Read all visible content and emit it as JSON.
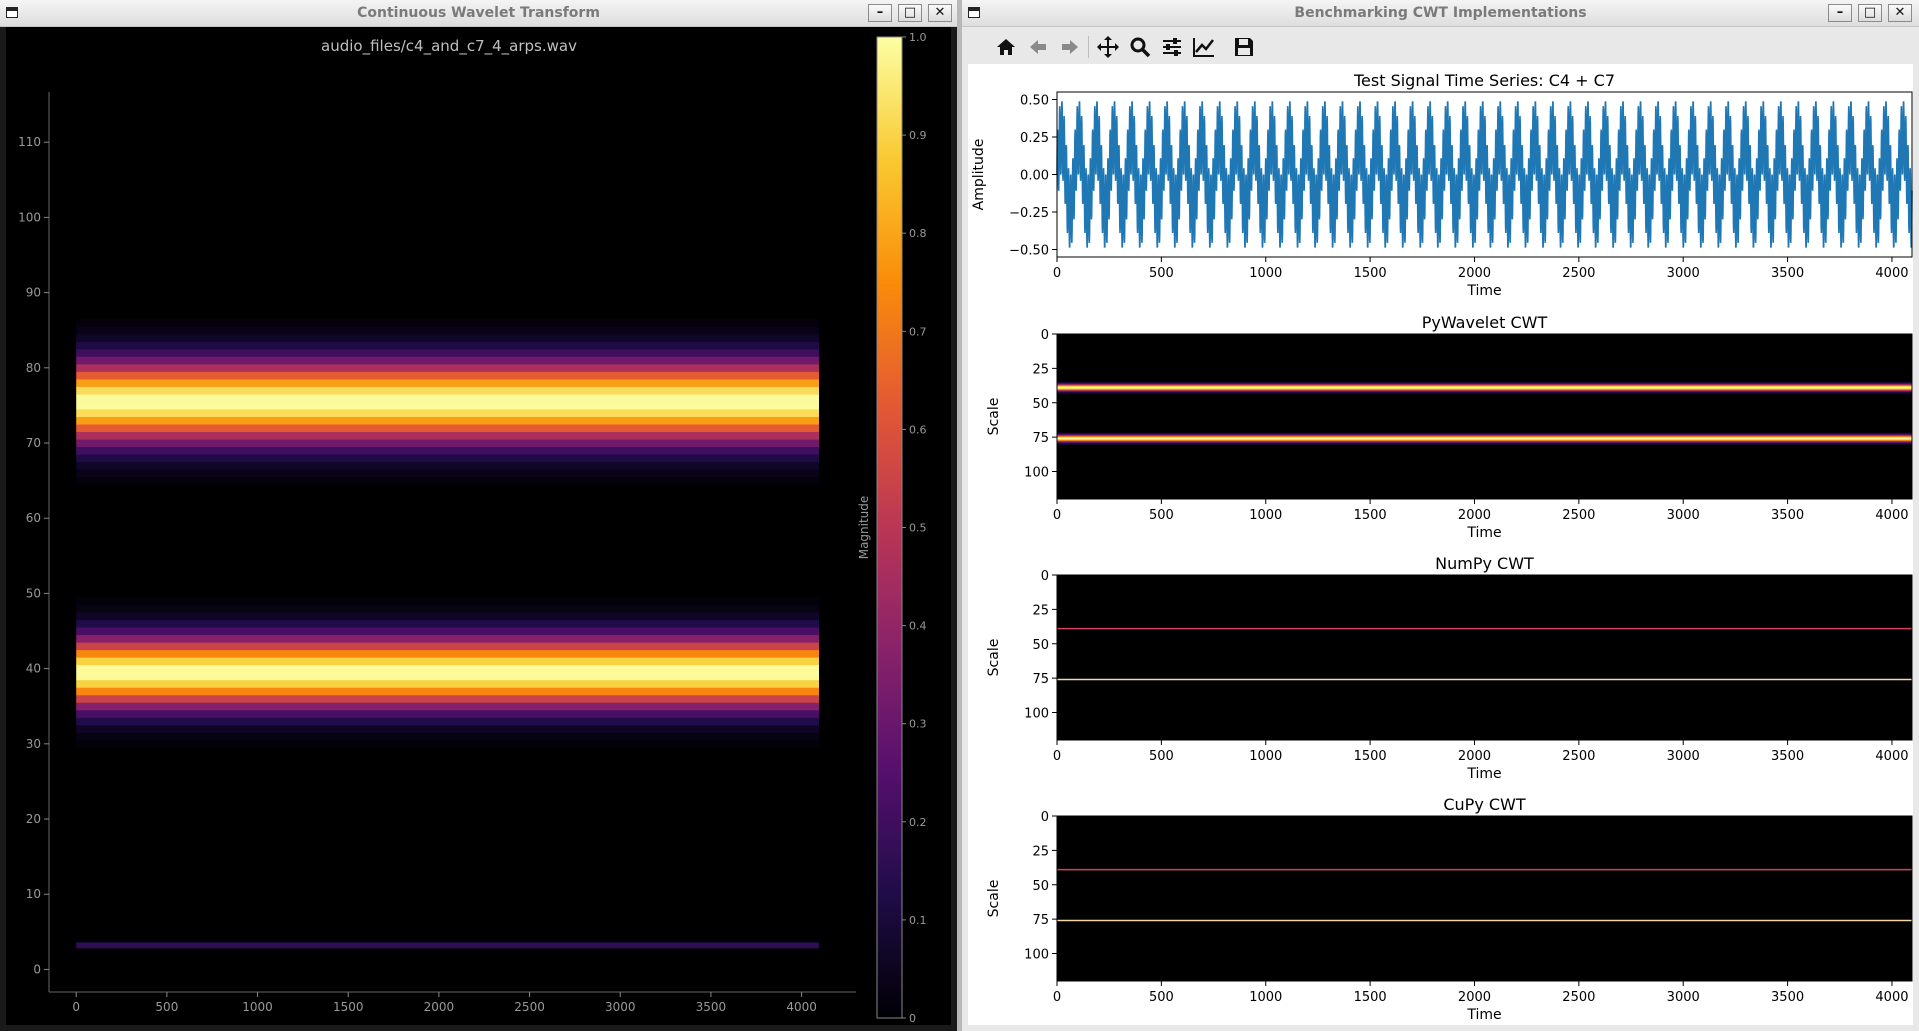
{
  "cwt_window": {
    "title": "Continuous Wavelet Transform",
    "chart_title": "audio_files/c4_and_c7_4_arps.wav",
    "colorbar_label": "Magnitude"
  },
  "bench_window": {
    "title": "Benchmarking CWT Implementations",
    "toolbar": [
      {
        "name": "home-icon",
        "glyph": "⌂"
      },
      {
        "name": "back-arrow-icon",
        "glyph": "←"
      },
      {
        "name": "forward-arrow-icon",
        "glyph": "→"
      },
      {
        "name": "pan-icon",
        "glyph": "✥"
      },
      {
        "name": "zoom-icon",
        "glyph": "🔍"
      },
      {
        "name": "configure-subplots-icon",
        "glyph": "≡"
      },
      {
        "name": "edit-axis-icon",
        "glyph": "📈"
      },
      {
        "name": "save-icon",
        "glyph": "💾"
      }
    ]
  },
  "colors": {
    "timeseries": "#1f77b4",
    "inferno_low": "#000004",
    "inferno_high": "#fcffa4"
  },
  "chart_data": [
    {
      "id": "cwt-spectrogram",
      "type": "heatmap",
      "title": "audio_files/c4_and_c7_4_arps.wav",
      "xlabel": "",
      "ylabel": "",
      "xlim": [
        -150,
        4300
      ],
      "ylim": [
        -3,
        120
      ],
      "xticks": [
        0,
        500,
        1000,
        1500,
        2000,
        2500,
        3000,
        3500,
        4000
      ],
      "yticks": [
        0,
        10,
        20,
        30,
        40,
        50,
        60,
        70,
        80,
        90,
        100,
        110
      ],
      "data_x_range": [
        0,
        4096
      ],
      "bands": [
        {
          "center": 75.5,
          "halfwidth": 8,
          "peak": 1.0
        },
        {
          "center": 39.5,
          "halfwidth": 7,
          "peak": 1.0
        }
      ],
      "colormap": "inferno",
      "colorbar": {
        "label": "Magnitude",
        "range": [
          0,
          1
        ],
        "ticks": [
          0,
          0.1,
          0.2,
          0.3,
          0.4,
          0.5,
          0.6,
          0.7,
          0.8,
          0.9,
          1.0
        ]
      }
    },
    {
      "id": "test-signal",
      "type": "line",
      "title": "Test Signal Time Series: C4 + C7",
      "xlabel": "Time",
      "ylabel": "Amplitude",
      "xlim": [
        0,
        4096
      ],
      "ylim": [
        -0.55,
        0.55
      ],
      "xticks": [
        0,
        500,
        1000,
        1500,
        2000,
        2500,
        3000,
        3500,
        4000
      ],
      "yticks": [
        -0.5,
        -0.25,
        0.0,
        0.25,
        0.5
      ],
      "signal": {
        "components": [
          {
            "amplitude": 0.25,
            "period": 84
          },
          {
            "amplitude": 0.25,
            "period": 10.5
          }
        ]
      }
    },
    {
      "id": "pywavelet-cwt",
      "type": "heatmap",
      "title": "PyWavelet CWT",
      "xlabel": "Time",
      "ylabel": "Scale",
      "xlim": [
        0,
        4096
      ],
      "ylim": [
        120,
        0
      ],
      "xticks": [
        0,
        500,
        1000,
        1500,
        2000,
        2500,
        3000,
        3500,
        4000
      ],
      "yticks": [
        0,
        25,
        50,
        75,
        100
      ],
      "bands": [
        {
          "center": 39,
          "halfwidth": 4
        },
        {
          "center": 76,
          "halfwidth": 4
        }
      ]
    },
    {
      "id": "numpy-cwt",
      "type": "heatmap",
      "title": "NumPy CWT",
      "xlabel": "Time",
      "ylabel": "Scale",
      "xlim": [
        0,
        4096
      ],
      "ylim": [
        120,
        0
      ],
      "xticks": [
        0,
        500,
        1000,
        1500,
        2000,
        2500,
        3000,
        3500,
        4000
      ],
      "yticks": [
        0,
        25,
        50,
        75,
        100
      ],
      "lines": [
        {
          "scale": 39,
          "color": "#d1455a"
        },
        {
          "scale": 76,
          "color": "#f4d6a8"
        }
      ]
    },
    {
      "id": "cupy-cwt",
      "type": "heatmap",
      "title": "CuPy CWT",
      "xlabel": "Time",
      "ylabel": "Scale",
      "xlim": [
        0,
        4096
      ],
      "ylim": [
        120,
        0
      ],
      "xticks": [
        0,
        500,
        1000,
        1500,
        2000,
        2500,
        3000,
        3500,
        4000
      ],
      "yticks": [
        0,
        25,
        50,
        75,
        100
      ],
      "lines": [
        {
          "scale": 39,
          "color": "#d1455a"
        },
        {
          "scale": 76,
          "color": "#f4d6a8"
        }
      ]
    }
  ]
}
